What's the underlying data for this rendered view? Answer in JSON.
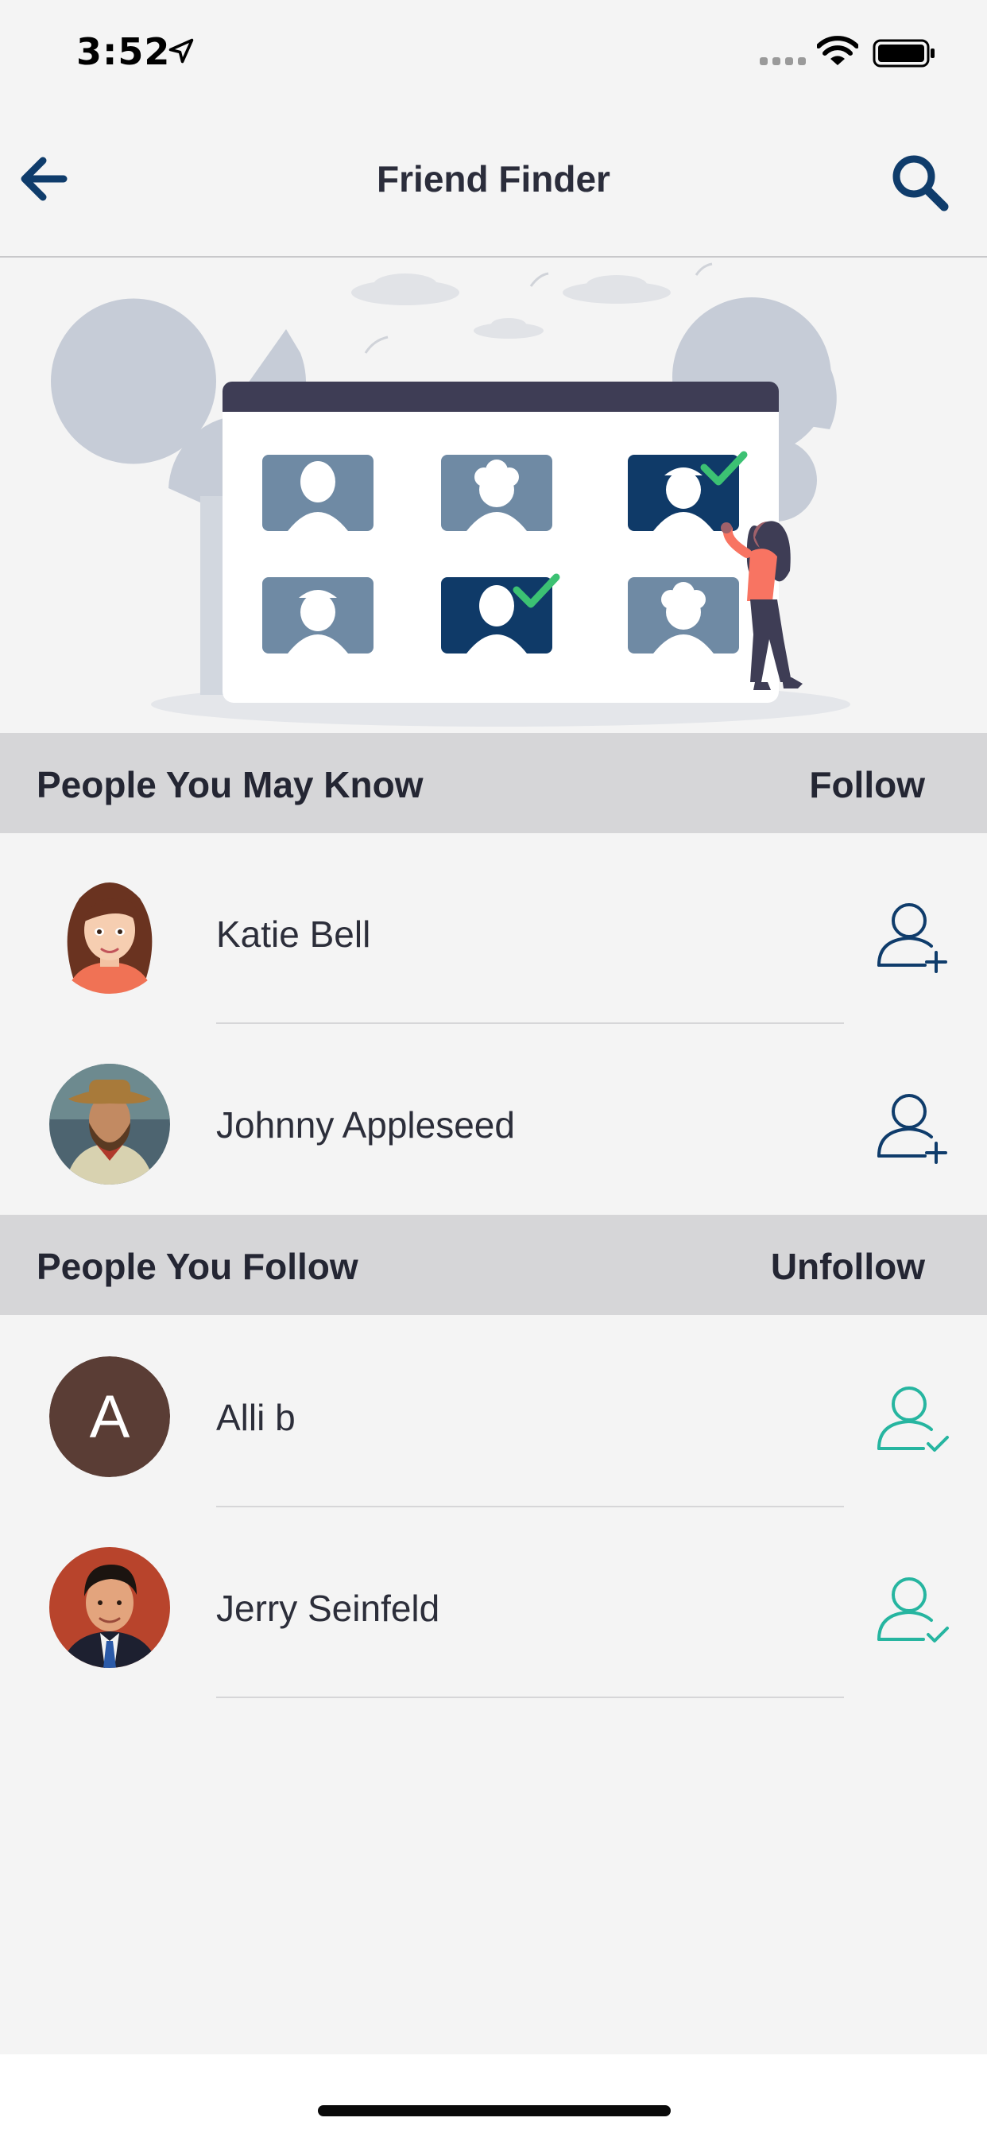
{
  "status_bar": {
    "time": "3:52",
    "icons": [
      "location-arrow-icon",
      "cellular-signal-icon",
      "wifi-icon",
      "battery-icon"
    ]
  },
  "header": {
    "title": "Friend Finder",
    "back_icon": "back-arrow-icon",
    "search_icon": "search-icon"
  },
  "colors": {
    "primary": "#0f3c6b",
    "follow_icon": "#0f3c6b",
    "unfollow_icon": "#26b5a0",
    "section_bg": "#d6d6d8",
    "page_bg": "#f4f4f4"
  },
  "sections": [
    {
      "title": "People You May Know",
      "action_label": "Follow",
      "people": [
        {
          "name": "Katie Bell",
          "action_icon": "add-user-icon"
        },
        {
          "name": "Johnny Appleseed",
          "action_icon": "add-user-icon"
        }
      ]
    },
    {
      "title": "People You Follow",
      "action_label": "Unfollow",
      "people": [
        {
          "name": "Alli b",
          "avatar_letter": "A",
          "action_icon": "user-check-icon"
        },
        {
          "name": "Jerry Seinfeld",
          "action_icon": "user-check-icon"
        }
      ]
    }
  ]
}
